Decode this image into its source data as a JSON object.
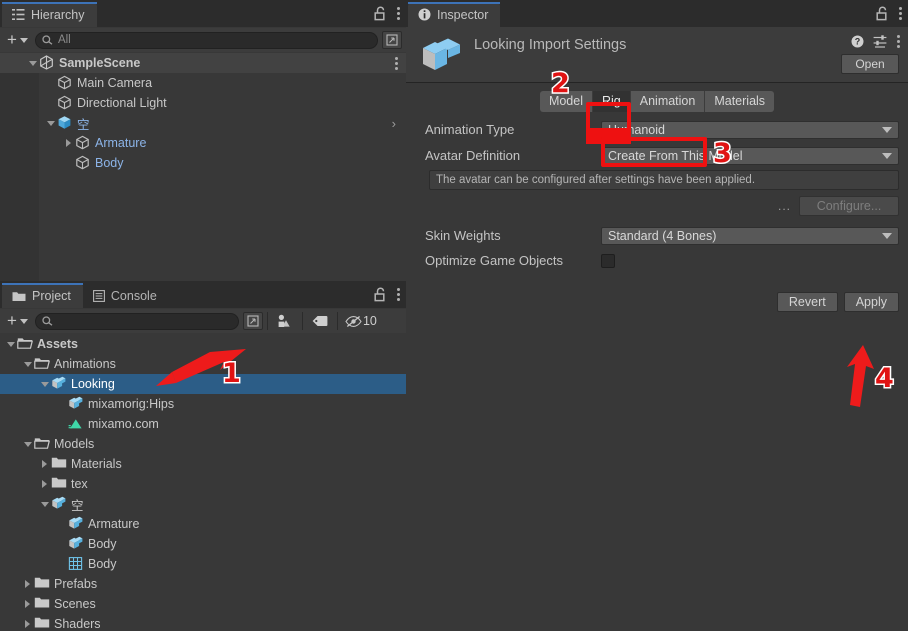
{
  "app": "Unity Editor",
  "accent_color": "#3d73b8",
  "selection_color": "#2c5d87",
  "annotation_color": "#e01313",
  "hierarchy": {
    "tab_label": "Hierarchy",
    "tab_icon": "hierarchy-icon",
    "lock_icon": "lock-open-icon",
    "menu_icon": "kebab-menu-icon",
    "toolbar": {
      "add_label": "+",
      "search_placeholder": "All",
      "search_value": "",
      "search_icon": "search-icon",
      "expand_icon": "expand-search-icon"
    },
    "tree": [
      {
        "label": "SampleScene",
        "depth": 1,
        "icon": "unity-scene-icon",
        "twisty": "down",
        "header": true,
        "blue": false,
        "menu": true
      },
      {
        "label": "Main Camera",
        "depth": 2,
        "icon": "gameobject-cube-icon",
        "twisty": "none",
        "header": false,
        "blue": false
      },
      {
        "label": "Directional Light",
        "depth": 2,
        "icon": "gameobject-cube-icon",
        "twisty": "none",
        "header": false,
        "blue": false
      },
      {
        "label": "空",
        "depth": 2,
        "icon": "prefab-cube-icon",
        "twisty": "down",
        "header": false,
        "blue": true,
        "chevron": true
      },
      {
        "label": "Armature",
        "depth": 3,
        "icon": "gameobject-cube-icon",
        "twisty": "right",
        "header": false,
        "blue": true
      },
      {
        "label": "Body",
        "depth": 3,
        "icon": "gameobject-cube-icon",
        "twisty": "none",
        "header": false,
        "blue": true
      }
    ]
  },
  "project": {
    "tabs": [
      {
        "label": "Project",
        "icon": "folder-icon",
        "active": true
      },
      {
        "label": "Console",
        "icon": "console-icon",
        "active": false
      }
    ],
    "lock_icon": "lock-open-icon",
    "menu_icon": "kebab-menu-icon",
    "toolbar": {
      "add_label": "+",
      "search_placeholder": "",
      "search_value": "",
      "search_icon": "search-icon",
      "expand_icon": "expand-search-icon",
      "type_filter_icon": "object-filter-icon",
      "label_filter_icon": "tag-icon",
      "hidden_icon": "eye-off-icon",
      "hidden_count": "10"
    },
    "tree": [
      {
        "label": "Assets",
        "depth": 1,
        "icon": "folder-open-icon",
        "twisty": "down",
        "bold": true,
        "selected": false
      },
      {
        "label": "Animations",
        "depth": 2,
        "icon": "folder-open-icon",
        "twisty": "down",
        "bold": false,
        "selected": false
      },
      {
        "label": "Looking",
        "depth": 3,
        "icon": "model-icon",
        "twisty": "down",
        "bold": false,
        "selected": true
      },
      {
        "label": "mixamorig:Hips",
        "depth": 4,
        "icon": "model-icon",
        "twisty": "none",
        "bold": false,
        "selected": false
      },
      {
        "label": "mixamo.com",
        "depth": 4,
        "icon": "animation-clip-icon",
        "twisty": "none",
        "bold": false,
        "selected": false
      },
      {
        "label": "Models",
        "depth": 2,
        "icon": "folder-open-icon",
        "twisty": "down",
        "bold": false,
        "selected": false
      },
      {
        "label": "Materials",
        "depth": 3,
        "icon": "folder-icon",
        "twisty": "right",
        "bold": false,
        "selected": false
      },
      {
        "label": "tex",
        "depth": 3,
        "icon": "folder-icon",
        "twisty": "right",
        "bold": false,
        "selected": false
      },
      {
        "label": "空",
        "depth": 3,
        "icon": "model-icon",
        "twisty": "down",
        "bold": false,
        "selected": false
      },
      {
        "label": "Armature",
        "depth": 4,
        "icon": "model-icon",
        "twisty": "none",
        "bold": false,
        "selected": false
      },
      {
        "label": "Body",
        "depth": 4,
        "icon": "model-icon",
        "twisty": "none",
        "bold": false,
        "selected": false
      },
      {
        "label": "Body",
        "depth": 4,
        "icon": "mesh-icon",
        "twisty": "none",
        "bold": false,
        "selected": false
      },
      {
        "label": "Prefabs",
        "depth": 2,
        "icon": "folder-icon",
        "twisty": "right",
        "bold": false,
        "selected": false
      },
      {
        "label": "Scenes",
        "depth": 2,
        "icon": "folder-icon",
        "twisty": "right",
        "bold": false,
        "selected": false
      },
      {
        "label": "Shaders",
        "depth": 2,
        "icon": "folder-icon",
        "twisty": "right",
        "bold": false,
        "selected": false
      }
    ]
  },
  "inspector": {
    "tab_label": "Inspector",
    "tab_icon": "info-icon",
    "lock_icon": "lock-open-icon",
    "menu_icon": "kebab-menu-icon",
    "title": "Looking Import Settings",
    "asset_icon": "model-import-icon",
    "help_icon": "help-icon",
    "preset_icon": "preset-icon",
    "header_menu_icon": "kebab-menu-icon",
    "open_button": "Open",
    "tabs": [
      {
        "label": "Model",
        "active": false
      },
      {
        "label": "Rig",
        "active": true
      },
      {
        "label": "Animation",
        "active": false
      },
      {
        "label": "Materials",
        "active": false
      }
    ],
    "fields": [
      {
        "name": "Animation Type",
        "value": "Humanoid",
        "dropdown": true
      },
      {
        "name": "Avatar Definition",
        "value": "Create From This Model",
        "dropdown": true
      }
    ],
    "help_text": "The avatar can be configured after settings have been applied.",
    "configure_ellipsis": "...",
    "configure_button": "Configure...",
    "skin_weights": {
      "name": "Skin Weights",
      "value": "Standard (4 Bones)"
    },
    "optimize": {
      "name": "Optimize Game Objects",
      "checked": false
    },
    "revert_button": "Revert",
    "apply_button": "Apply"
  },
  "annotations": [
    {
      "id": "1",
      "number": "1",
      "target": "project-row-looking"
    },
    {
      "id": "2",
      "number": "2",
      "target": "inspector-tab-rig"
    },
    {
      "id": "3",
      "number": "3",
      "target": "animation-type-value"
    },
    {
      "id": "4",
      "number": "4",
      "target": "apply-button"
    }
  ]
}
